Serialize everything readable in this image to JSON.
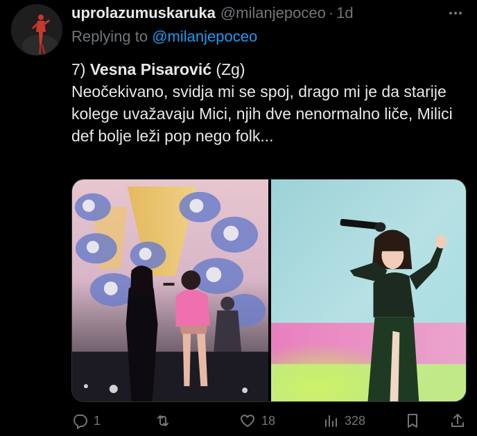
{
  "tweet": {
    "display_name": "uprolazumuskaruka",
    "handle": "@milanjepoceo",
    "separator": "·",
    "time": "1d",
    "replying_prefix": "Replying to",
    "replying_to": "@milanjepoceo",
    "line1_num": "7) ",
    "line1_name": "Vesna Pisarović",
    "line1_suffix": " (Zg)",
    "body": "Neočekivano, svidja mi se spoj, drago mi je da starije kolege uvažavaju Mici, njih dve nenormalno liče, Milici def bolje leži pop nego folk..."
  },
  "actions": {
    "reply_count": "1",
    "retweet_count": "",
    "like_count": "18",
    "views_count": "328"
  },
  "icons": {
    "more": "more-horizontal-icon",
    "reply": "reply-icon",
    "retweet": "retweet-icon",
    "like": "heart-icon",
    "views": "views-chart-icon",
    "bookmark": "bookmark-icon",
    "share": "share-icon"
  },
  "colors": {
    "background": "#000000",
    "text": "#e7e9ea",
    "muted": "#71767b",
    "link": "#1d9bf0"
  }
}
